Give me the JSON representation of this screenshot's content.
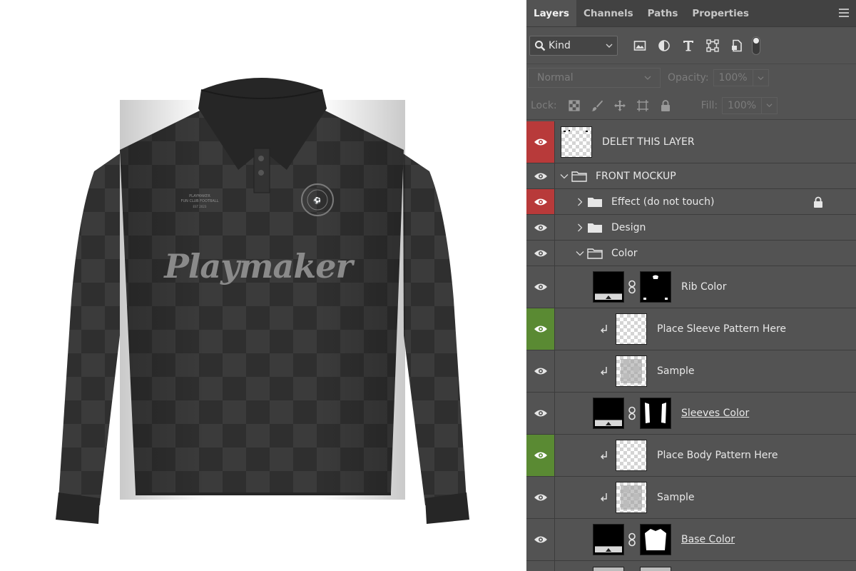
{
  "panel": {
    "tabs": [
      {
        "label": "Layers",
        "active": true
      },
      {
        "label": "Channels",
        "active": false
      },
      {
        "label": "Paths",
        "active": false
      },
      {
        "label": "Properties",
        "active": false
      }
    ],
    "filter": {
      "kind_label": "Kind"
    },
    "blend": {
      "mode": "Normal",
      "opacity_label": "Opacity:",
      "opacity_value": "100%"
    },
    "lock": {
      "lock_label": "Lock:",
      "fill_label": "Fill:",
      "fill_value": "100%"
    },
    "colors": {
      "panel_bg": "#535353",
      "tab_bg": "#424242",
      "eye_red": "#b83a3a",
      "eye_green": "#5a8a33"
    }
  },
  "layers": [
    {
      "name": "DELET THIS LAYER",
      "eye": "red",
      "type": "layer"
    },
    {
      "name": "FRONT MOCKUP",
      "eye": "normal",
      "type": "group-open"
    },
    {
      "name": "Effect  (do not touch)",
      "eye": "red",
      "type": "group-closed",
      "locked": true
    },
    {
      "name": "Design",
      "eye": "normal",
      "type": "group-closed"
    },
    {
      "name": "Color",
      "eye": "normal",
      "type": "group-open"
    },
    {
      "name": "Rib Color",
      "eye": "normal",
      "type": "fill-mask"
    },
    {
      "name": "Place Sleeve Pattern Here",
      "eye": "green",
      "type": "clipped"
    },
    {
      "name": "Sample",
      "eye": "normal",
      "type": "clipped-sample"
    },
    {
      "name": "Sleeves Color",
      "eye": "normal",
      "type": "fill-mask",
      "underline": true
    },
    {
      "name": "Place Body Pattern Here",
      "eye": "green",
      "type": "clipped"
    },
    {
      "name": "Sample",
      "eye": "normal",
      "type": "clipped-sample"
    },
    {
      "name": "Base Color",
      "eye": "normal",
      "type": "fill-mask",
      "underline": true
    }
  ],
  "mockup": {
    "brand_wordmark": "Playmaker",
    "chest_text_line1": "PLAYMAKER",
    "chest_text_line2": "FUN CLUB FOOTBALL",
    "chest_text_line3": "EST 2023",
    "shirt_color": "#3a3a3a"
  }
}
